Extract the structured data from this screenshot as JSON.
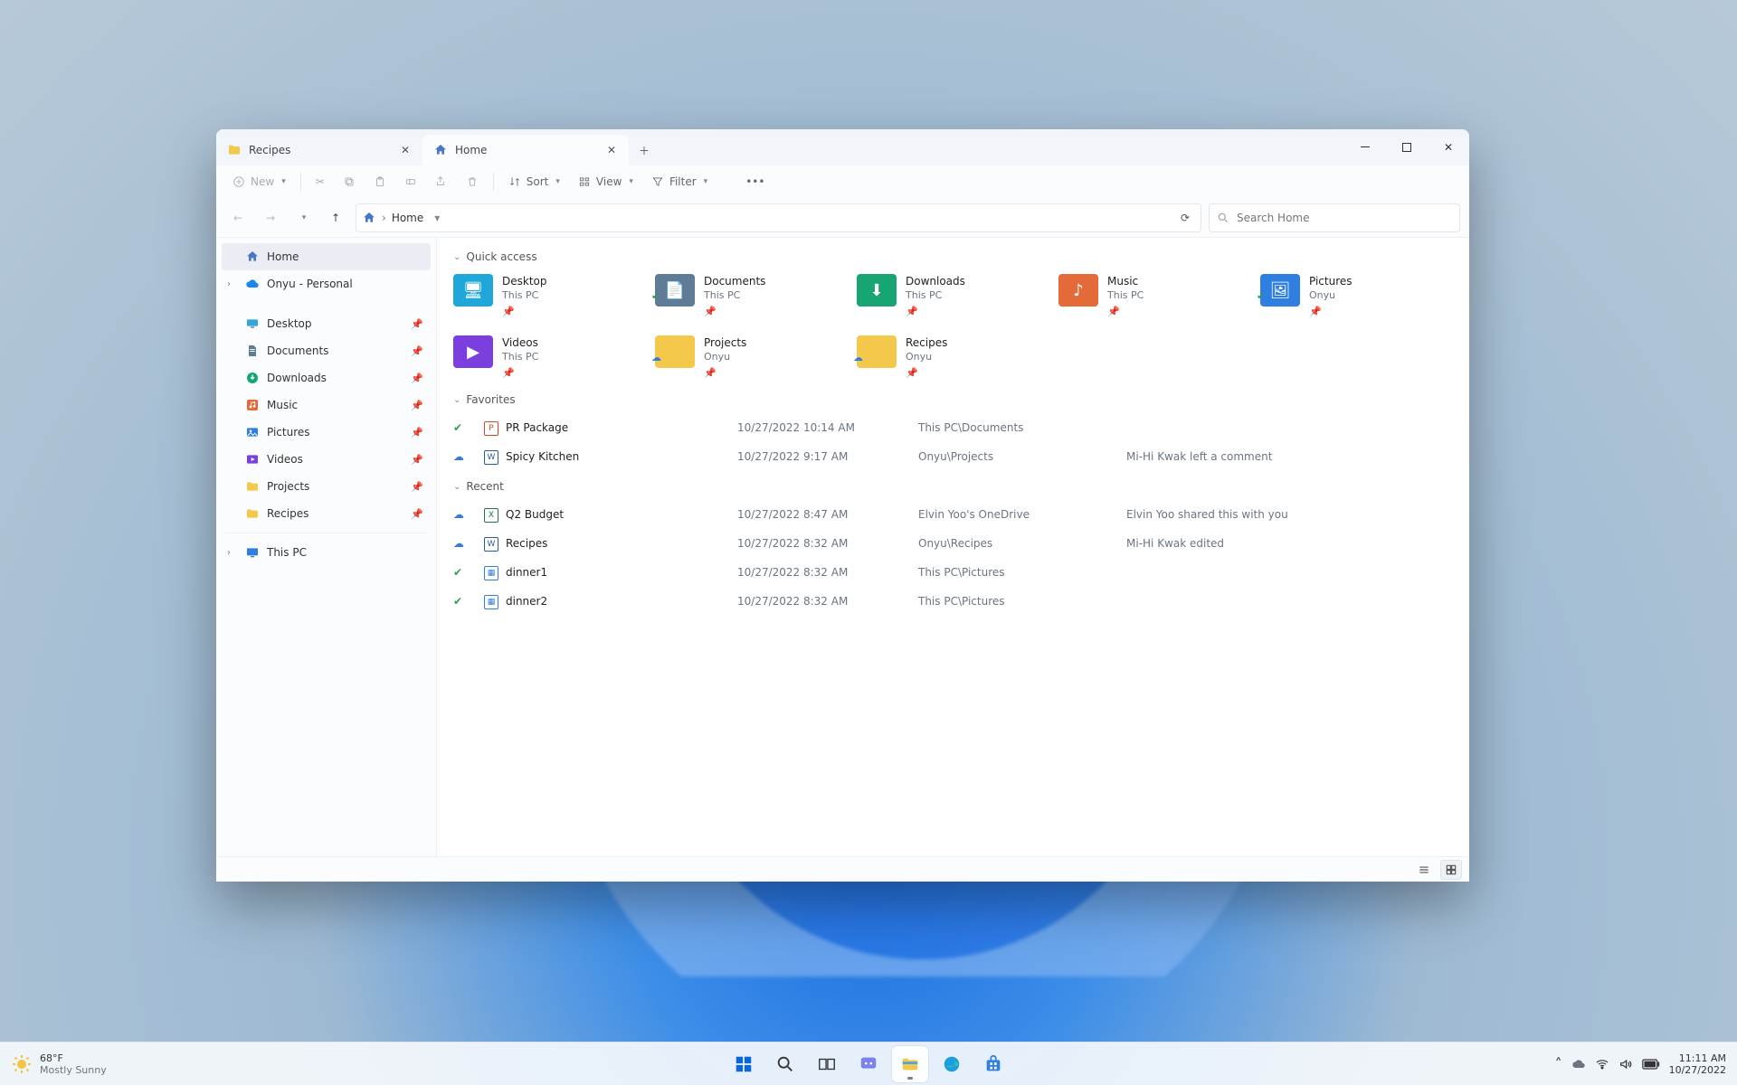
{
  "window": {
    "tabs": [
      {
        "label": "Recipes",
        "active": false
      },
      {
        "label": "Home",
        "active": true
      }
    ]
  },
  "toolbar": {
    "new": "New",
    "sort": "Sort",
    "view": "View",
    "filter": "Filter"
  },
  "address": {
    "crumb_root_icon": "home-icon",
    "crumb": "Home"
  },
  "search": {
    "placeholder": "Search Home"
  },
  "sidebar": {
    "home": "Home",
    "onedrive": "Onyu - Personal",
    "pinned": [
      {
        "label": "Desktop"
      },
      {
        "label": "Documents"
      },
      {
        "label": "Downloads"
      },
      {
        "label": "Music"
      },
      {
        "label": "Pictures"
      },
      {
        "label": "Videos"
      },
      {
        "label": "Projects"
      },
      {
        "label": "Recipes"
      }
    ],
    "thispc": "This PC"
  },
  "sections": {
    "quick": "Quick access",
    "favorites": "Favorites",
    "recent": "Recent"
  },
  "quick_access": [
    {
      "name": "Desktop",
      "sub": "This PC",
      "color": "#1ea7d8",
      "glyph": "🖥",
      "status": ""
    },
    {
      "name": "Documents",
      "sub": "This PC",
      "color": "#5f7b95",
      "glyph": "📄",
      "status": "sync-ok"
    },
    {
      "name": "Downloads",
      "sub": "This PC",
      "color": "#17a673",
      "glyph": "⬇",
      "status": ""
    },
    {
      "name": "Music",
      "sub": "This PC",
      "color": "#e46a3a",
      "glyph": "♪",
      "status": ""
    },
    {
      "name": "Pictures",
      "sub": "Onyu",
      "color": "#2f7fe0",
      "glyph": "🖼",
      "status": "sync-ok"
    },
    {
      "name": "Videos",
      "sub": "This PC",
      "color": "#7b3fe0",
      "glyph": "▶",
      "status": ""
    },
    {
      "name": "Projects",
      "sub": "Onyu",
      "color": "#f4c94b",
      "glyph": "",
      "status": "cloud"
    },
    {
      "name": "Recipes",
      "sub": "Onyu",
      "color": "#f4c94b",
      "glyph": "",
      "status": "cloud"
    }
  ],
  "favorites": [
    {
      "status": "sync-ok",
      "icon": "ppt",
      "name": "PR Package",
      "date": "10/27/2022 10:14 AM",
      "loc": "This PC\\Documents",
      "note": ""
    },
    {
      "status": "cloud",
      "icon": "word",
      "name": "Spicy Kitchen",
      "date": "10/27/2022 9:17 AM",
      "loc": "Onyu\\Projects",
      "note": "Mi-Hi Kwak left a comment"
    }
  ],
  "recent": [
    {
      "status": "cloud",
      "icon": "xls",
      "name": "Q2 Budget",
      "date": "10/27/2022 8:47 AM",
      "loc": "Elvin Yoo's OneDrive",
      "note": "Elvin Yoo shared this with you"
    },
    {
      "status": "cloud",
      "icon": "word",
      "name": "Recipes",
      "date": "10/27/2022 8:32 AM",
      "loc": "Onyu\\Recipes",
      "note": "Mi-Hi Kwak edited"
    },
    {
      "status": "sync-ok",
      "icon": "img",
      "name": "dinner1",
      "date": "10/27/2022 8:32 AM",
      "loc": "This PC\\Pictures",
      "note": ""
    },
    {
      "status": "sync-ok",
      "icon": "img",
      "name": "dinner2",
      "date": "10/27/2022 8:32 AM",
      "loc": "This PC\\Pictures",
      "note": ""
    }
  ],
  "taskbar": {
    "weather_temp": "68°F",
    "weather_label": "Mostly Sunny",
    "time": "11:11 AM",
    "date": "10/27/2022"
  }
}
